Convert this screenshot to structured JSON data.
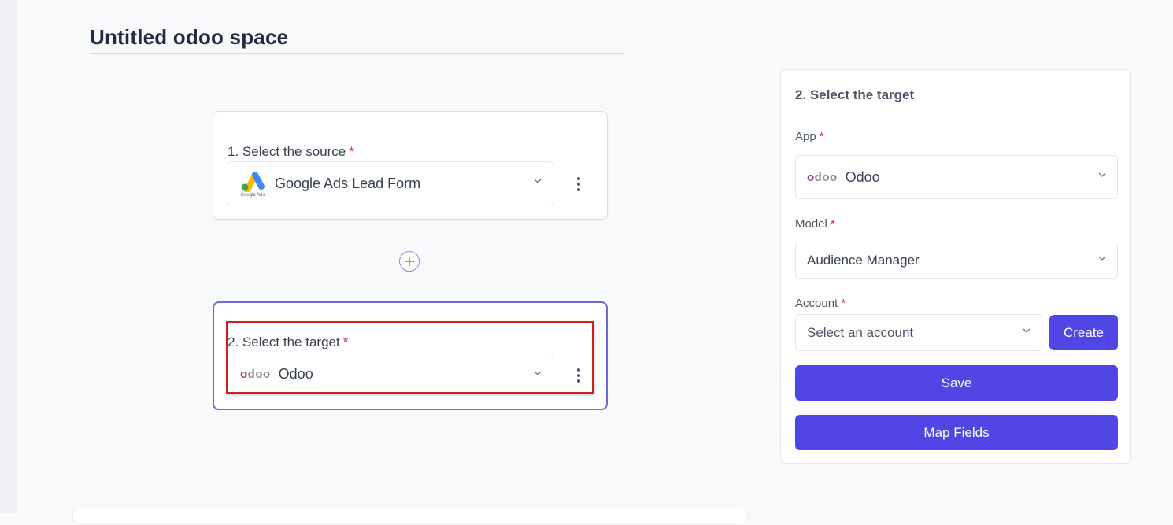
{
  "page": {
    "title": "Untitled odoo space"
  },
  "flow": {
    "source": {
      "step_label": "1.  Select the source",
      "required_mark": "*",
      "selected_app": "Google Ads Lead Form",
      "logo_caption": "Google Ads",
      "icon": "google-ads-icon"
    },
    "add_step_icon": "plus-icon",
    "target": {
      "step_label": "2.  Select the target",
      "required_mark": "*",
      "selected_app": "Odoo",
      "logo_text_first": "o",
      "logo_text_rest": "doo",
      "icon": "odoo-logo-icon"
    }
  },
  "panel": {
    "title": "2. Select the target",
    "app": {
      "label": "App",
      "required_mark": "*",
      "value": "Odoo",
      "logo_text_first": "o",
      "logo_text_rest": "doo"
    },
    "model": {
      "label": "Model",
      "required_mark": "*",
      "value": "Audience Manager"
    },
    "account": {
      "label": "Account",
      "required_mark": "*",
      "placeholder": "Select an account",
      "create_label": "Create"
    },
    "save_label": "Save",
    "map_fields_label": "Map Fields"
  },
  "colors": {
    "accent": "#4f46e5",
    "required": "#dc2626",
    "highlight": "#d01f1f",
    "odoo_purple": "#8e3f7a"
  }
}
